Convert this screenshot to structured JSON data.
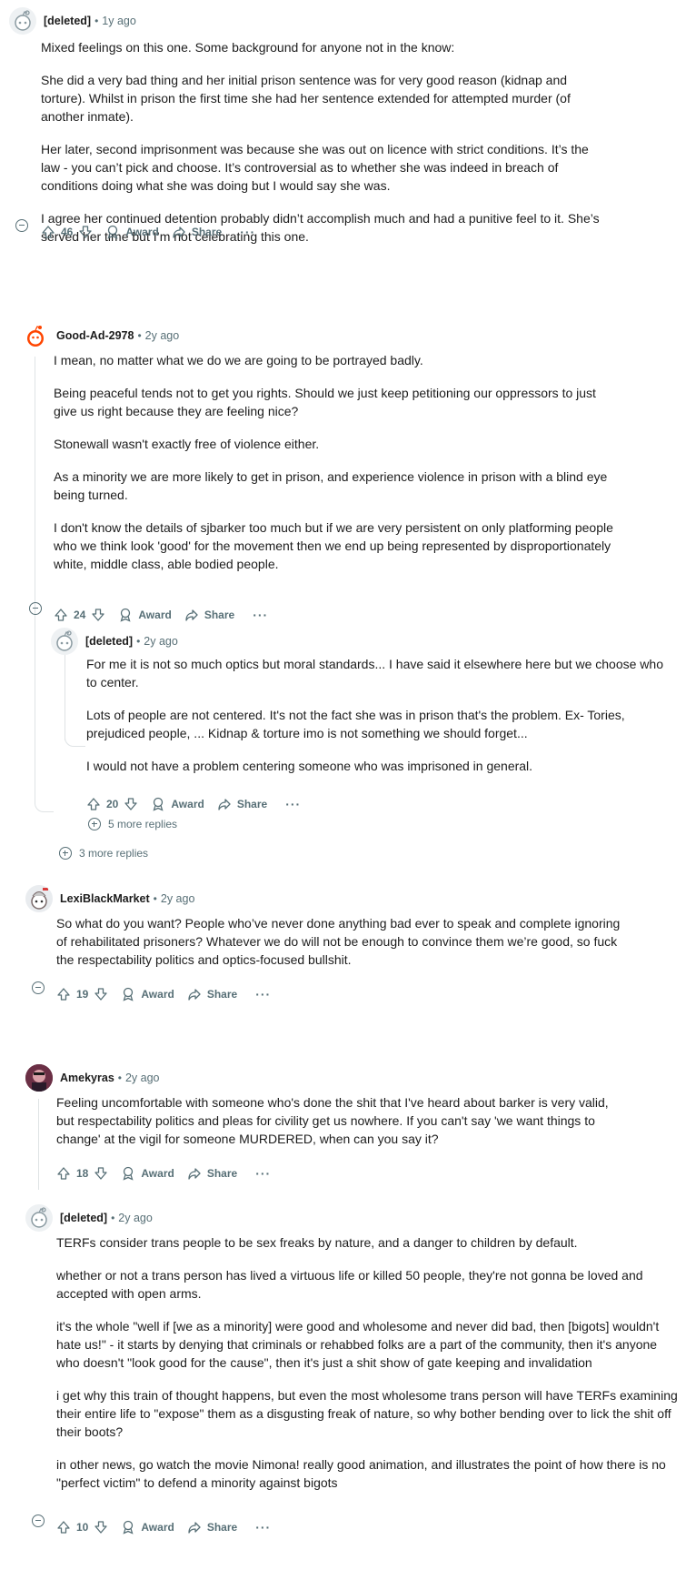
{
  "comments": [
    {
      "author": "[deleted]",
      "time": "1y ago",
      "paragraphs": [
        "Mixed feelings on this one. Some background for anyone not in the know:",
        "She did a very bad thing and her initial prison sentence was for very good reason (kidnap and torture). Whilst in prison the first time she had her sentence extended for attempted murder (of another inmate).",
        "Her later, second imprisonment was because she was out on licence with strict conditions. It’s the law - you can’t pick and choose. It’s controversial as to whether she was indeed in breach of conditions doing what she was doing but I would say she was.",
        "I agree her continued detention probably didn’t accomplish much and had a punitive feel to it. She’s served her time but I’m not celebrating this one."
      ],
      "score": "46"
    },
    {
      "author": "Good-Ad-2978",
      "time": "2y ago",
      "paragraphs": [
        "I mean, no matter what we do we are going to be portrayed badly.",
        "Being peaceful tends not to get you rights. Should we just keep petitioning our oppressors to just give us right because they are feeling nice?",
        "Stonewall wasn't exactly free of violence either.",
        "As a minority we are more likely to get in prison, and experience violence in prison with a blind eye being turned.",
        "I don't know the details of sjbarker too much but if we are very persistent on only platforming people who we think look 'good' for the movement then we end up being represented by disproportionately white, middle class, able bodied people."
      ],
      "score": "24"
    },
    {
      "author": "[deleted]",
      "time": "2y ago",
      "paragraphs": [
        "For me it is not so much optics but moral standards... I have said it elsewhere here but we choose who to center.",
        "Lots of people are not centered. It's not the fact she was in prison that's the problem. Ex- Tories, prejudiced people, ... Kidnap & torture imo is not something we should forget...",
        "I would not have a problem centering someone who was imprisoned in general."
      ],
      "score": "20",
      "more_replies": "5 more replies"
    },
    {
      "author": "LexiBlackMarket",
      "time": "2y ago",
      "paragraphs": [
        "So what do you want? People who’ve never done anything bad ever to speak and complete ignoring of rehabilitated prisoners? Whatever we do will not be enough to convince them we’re good, so fuck the respectability politics and optics-focused bullshit."
      ],
      "score": "19"
    },
    {
      "author": "Amekyras",
      "time": "2y ago",
      "paragraphs": [
        "Feeling uncomfortable with someone who's done the shit that I've heard about barker is very valid, but respectability politics and pleas for civility get us nowhere. If you can't say 'we want things to change' at the vigil for someone MURDERED, when can you say it?"
      ],
      "score": "18"
    },
    {
      "author": "[deleted]",
      "time": "2y ago",
      "paragraphs": [
        "TERFs consider trans people to be sex freaks by nature, and a danger to children by default.",
        "whether or not a trans person has lived a virtuous life or killed 50 people, they're not gonna be loved and accepted with open arms.",
        "it's the whole \"well if [we as a minority] were good and wholesome and never did bad, then [bigots] wouldn't hate us!\" - it starts by denying that criminals or rehabbed folks are a part of the community, then it's anyone who doesn't \"look good for the cause\", then it's just a shit show of gate keeping and invalidation",
        "i get why this train of thought happens, but even the most wholesome trans person will have TERFs examining their entire life to \"expose\" them as a disgusting freak of nature, so why bother bending over to lick the shit off their boots?",
        "in other news, go watch the movie Nimona! really good animation, and illustrates the point of how there is no \"perfect victim\" to defend a minority against bigots"
      ],
      "score": "10"
    }
  ],
  "thread2_more_replies": "3 more replies",
  "labels": {
    "award": "Award",
    "share": "Share",
    "more": "···",
    "separator": "•"
  },
  "colors": {
    "meta": "#576f76",
    "thread_line": "#dfe3e5",
    "text": "#1c1c1c"
  },
  "icons": [
    "upvote-icon",
    "downvote-icon",
    "award-icon",
    "share-icon",
    "collapse-icon",
    "expand-icon"
  ]
}
